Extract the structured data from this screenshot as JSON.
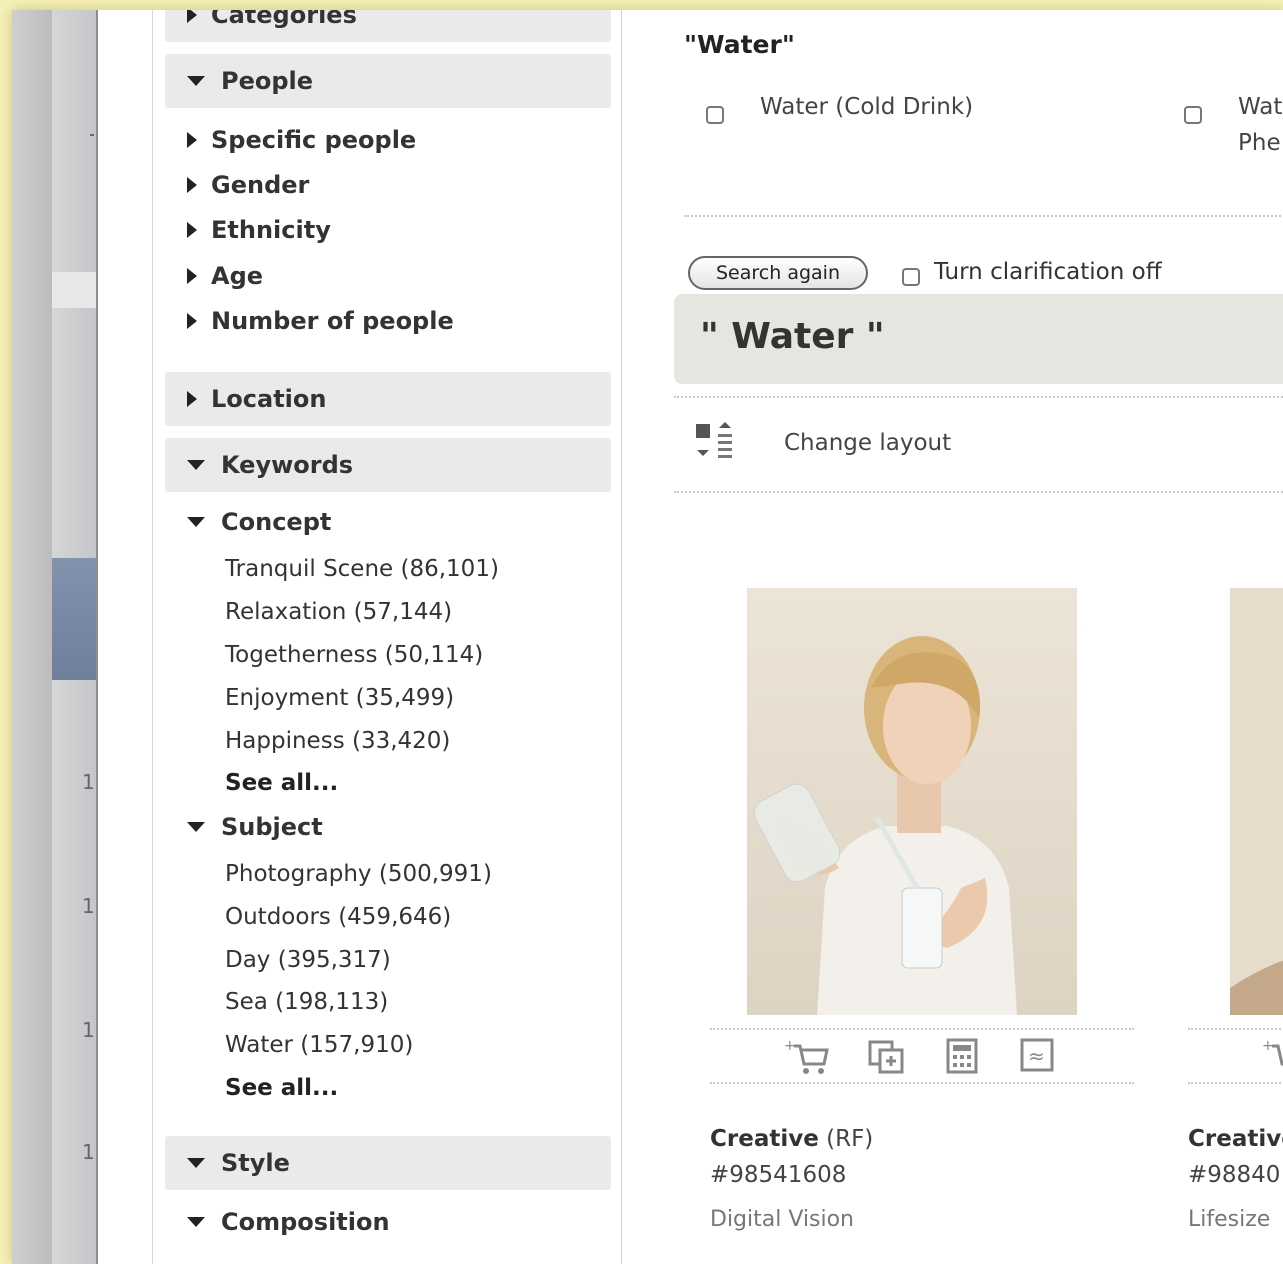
{
  "sidebar": {
    "categories": {
      "label": "Categories"
    },
    "people": {
      "label": "People",
      "items": [
        "Specific people",
        "Gender",
        "Ethnicity",
        "Age",
        "Number of people"
      ]
    },
    "location": {
      "label": "Location"
    },
    "keywords": {
      "label": "Keywords",
      "concept": {
        "label": "Concept",
        "items": [
          "Tranquil Scene (86,101)",
          "Relaxation (57,144)",
          "Togetherness (50,114)",
          "Enjoyment (35,499)",
          "Happiness (33,420)"
        ],
        "see_all": "See all..."
      },
      "subject": {
        "label": "Subject",
        "items": [
          "Photography (500,991)",
          "Outdoors (459,646)",
          "Day (395,317)",
          "Sea (198,113)",
          "Water (157,910)"
        ],
        "see_all": "See all..."
      }
    },
    "style": {
      "label": "Style",
      "composition": {
        "label": "Composition"
      }
    }
  },
  "main": {
    "clarify_title": "\"Water\"",
    "options": [
      "Water (Cold Drink)",
      "Wat",
      "Phe"
    ],
    "search_again": "Search again",
    "clarification_off": "Turn clarification off",
    "query": "\" Water \"",
    "change_layout": "Change layout",
    "results": [
      {
        "collection": "Creative",
        "license": " (RF)",
        "id": "#98541608",
        "source": "Digital Vision"
      },
      {
        "collection": "Creative",
        "license": "",
        "id": "#98840",
        "source": "Lifesize"
      }
    ]
  },
  "background": {
    "digits": [
      "1",
      "1",
      "1",
      "1"
    ]
  },
  "colors": {
    "frame_bg": "#f7f1b6",
    "header_bg": "#eaeaea",
    "query_bg": "#e6e6e1"
  }
}
